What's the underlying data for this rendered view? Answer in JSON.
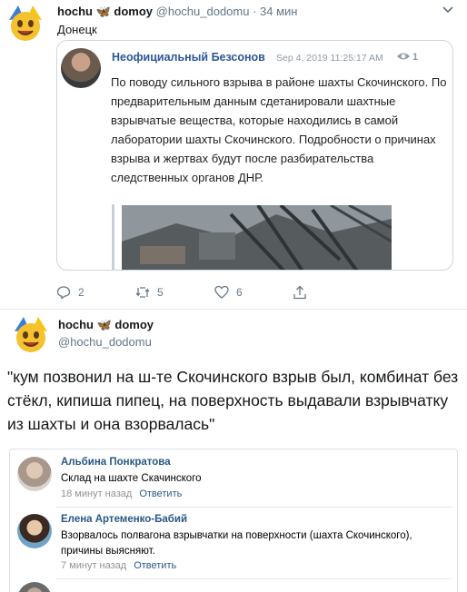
{
  "tweet1": {
    "display_name": "hochu 🦋 domoy",
    "handle": "@hochu_dodomu",
    "time": "· 34 мин",
    "text": "Донецк",
    "quote": {
      "author": "Неофициальный Безсонов",
      "date": "Sep 4, 2019 11:25:17 AM",
      "views": "1",
      "text": "По поводу сильного взрыва в районе шахты Скочинского. По предварительным данным сдетанировали шахтные взрывчатые вещества, которые находились в самой лаборатории шахты Скочинского. Подробности о причинах взрыва и жертвах будут после разбирательства следственных органов ДНР."
    },
    "actions": {
      "replies": "2",
      "retweets": "5",
      "likes": "6"
    }
  },
  "tweet2": {
    "display_name": "hochu 🦋 domoy",
    "handle": "@hochu_dodomu",
    "text": "\"кум позвонил на ш-те Скочинского взрыв был, комбинат без стёкл, кипиша пипец, на поверхность выдавали взрывчатку из шахты и она взорвалась\""
  },
  "comments": [
    {
      "author": "Альбина Понкратова",
      "text": "Склад на шахте Скачинского",
      "time": "18 минут назад",
      "reply": "Ответить"
    },
    {
      "author": "Елена Артеменко-Бабий",
      "text": "Взорвалось полвагона взрывчатки на поверхности (шахта Скочинского), причины выясняют.",
      "time": "7 минут назад",
      "reply": "Ответить"
    }
  ],
  "colors": {
    "vk_link": "#2a5885",
    "twitter_gray": "#657786"
  }
}
